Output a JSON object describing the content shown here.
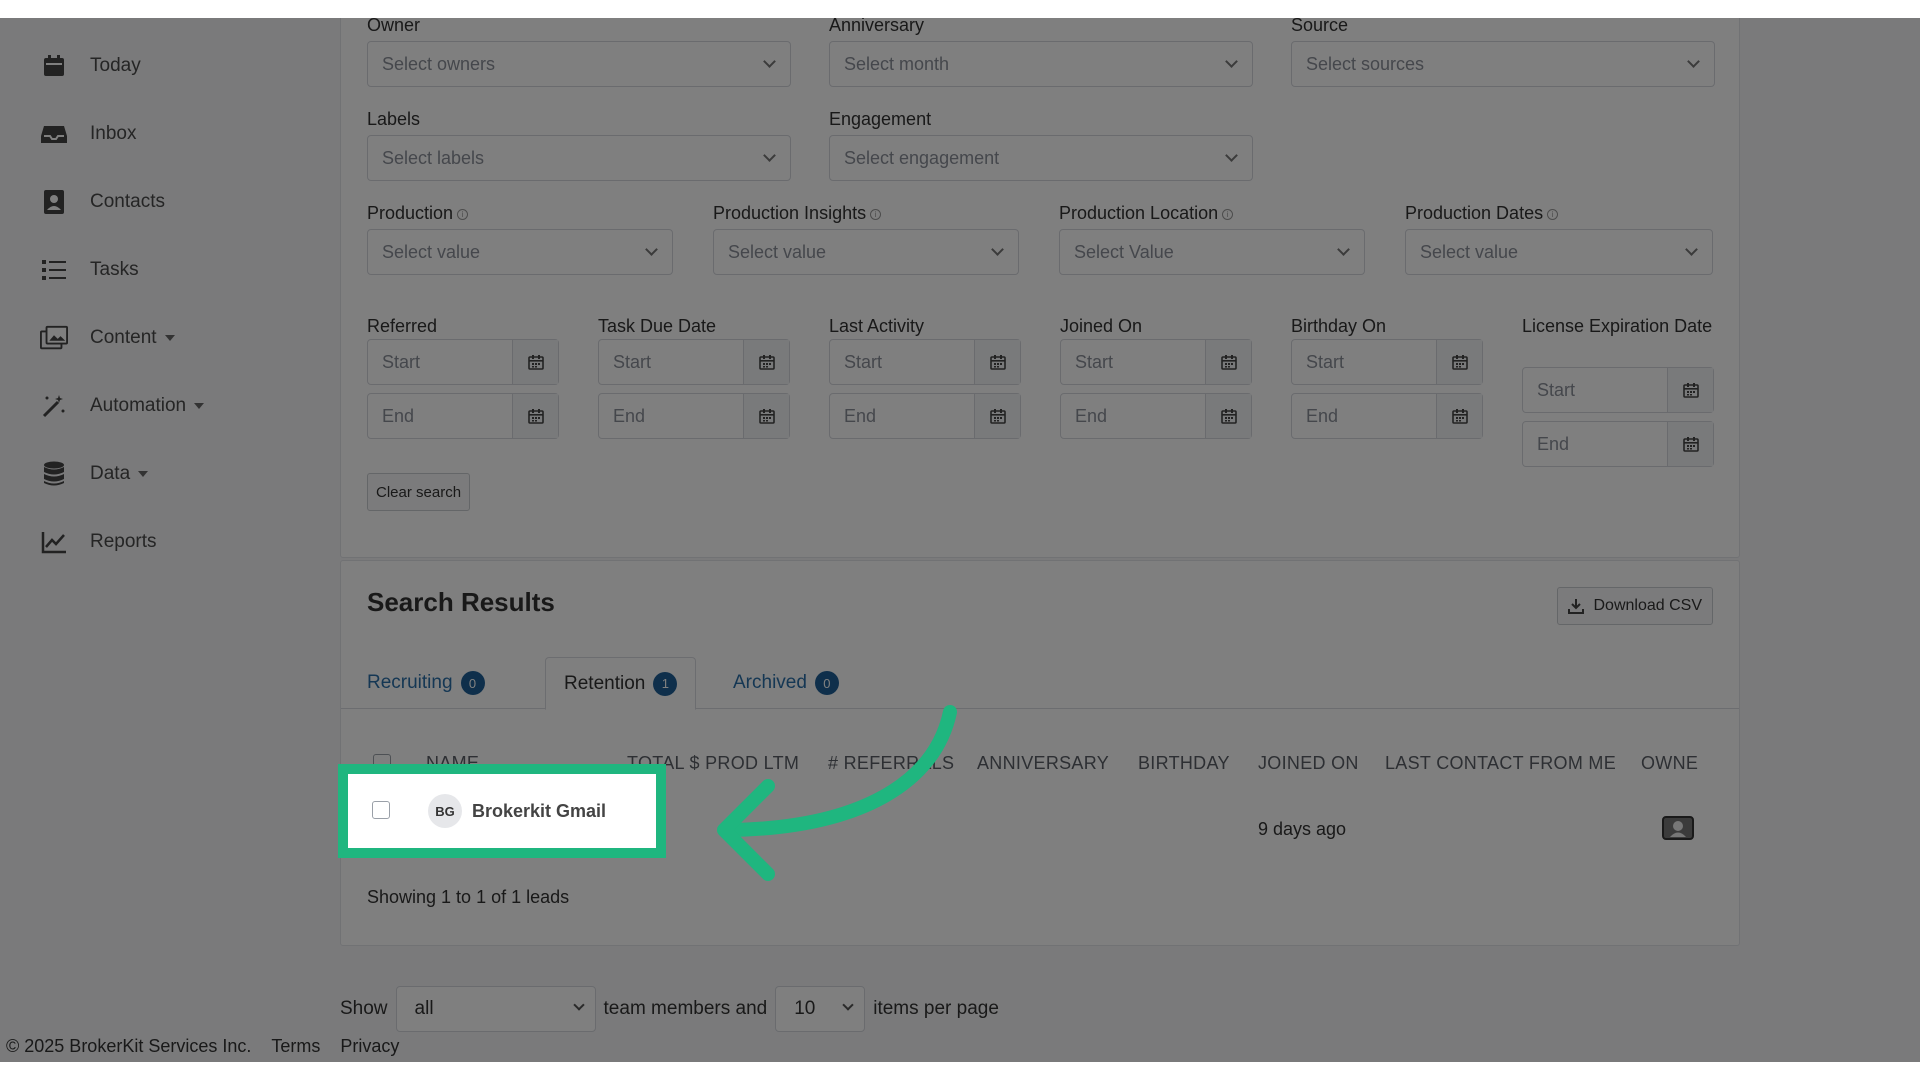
{
  "sidebar": {
    "items": [
      {
        "label": "Today",
        "icon": "calendar-icon"
      },
      {
        "label": "Inbox",
        "icon": "inbox-icon"
      },
      {
        "label": "Contacts",
        "icon": "contacts-icon"
      },
      {
        "label": "Tasks",
        "icon": "tasks-list-icon"
      },
      {
        "label": "Content",
        "icon": "content-icon"
      },
      {
        "label": "Automation",
        "icon": "magic-wand-icon"
      },
      {
        "label": "Data",
        "icon": "database-icon"
      },
      {
        "label": "Reports",
        "icon": "chart-line-icon"
      }
    ]
  },
  "filters": {
    "owner": {
      "label": "Owner",
      "placeholder": "Select owners"
    },
    "anniversary": {
      "label": "Anniversary",
      "placeholder": "Select month"
    },
    "source": {
      "label": "Source",
      "placeholder": "Select sources"
    },
    "labels": {
      "label": "Labels",
      "placeholder": "Select labels"
    },
    "engagement": {
      "label": "Engagement",
      "placeholder": "Select engagement"
    },
    "production": {
      "label": "Production",
      "placeholder": "Select value"
    },
    "production_insights": {
      "label": "Production Insights",
      "placeholder": "Select value"
    },
    "production_location": {
      "label": "Production Location",
      "placeholder": "Select Value"
    },
    "production_dates": {
      "label": "Production Dates",
      "placeholder": "Select value"
    },
    "start_placeholder": "Start",
    "end_placeholder": "End",
    "date_ranges": [
      {
        "label": "Referred"
      },
      {
        "label": "Task Due Date"
      },
      {
        "label": "Last Activity"
      },
      {
        "label": "Joined On"
      },
      {
        "label": "Birthday On"
      },
      {
        "label": "License Expiration Date"
      }
    ],
    "clear_label": "Clear search"
  },
  "results": {
    "title": "Search Results",
    "download_label": "Download CSV",
    "tabs": [
      {
        "label": "Recruiting",
        "count": "0"
      },
      {
        "label": "Retention",
        "count": "1"
      },
      {
        "label": "Archived",
        "count": "0"
      }
    ],
    "columns": [
      "NAME",
      "TOTAL $ PROD LTM",
      "# REFERRALS",
      "ANNIVERSARY",
      "BIRTHDAY",
      "JOINED ON",
      "LAST CONTACT FROM ME",
      "OWNE"
    ],
    "rows": [
      {
        "initials": "BG",
        "name": "Brokerkit Gmail",
        "joined_on": "9 days ago"
      }
    ],
    "showing": "Showing 1 to 1 of 1 leads"
  },
  "pagination": {
    "show_label": "Show",
    "members_value": "all",
    "team_members_label": "team members and",
    "per_page_value": "10",
    "items_per_page_label": "items per page"
  },
  "footer": {
    "copyright": "© 2025 BrokerKit Services Inc.",
    "terms": "Terms",
    "privacy": "Privacy"
  },
  "colors": {
    "accent": "#1fb67f",
    "link": "#2a6fa8",
    "badge": "#1f5f96"
  }
}
